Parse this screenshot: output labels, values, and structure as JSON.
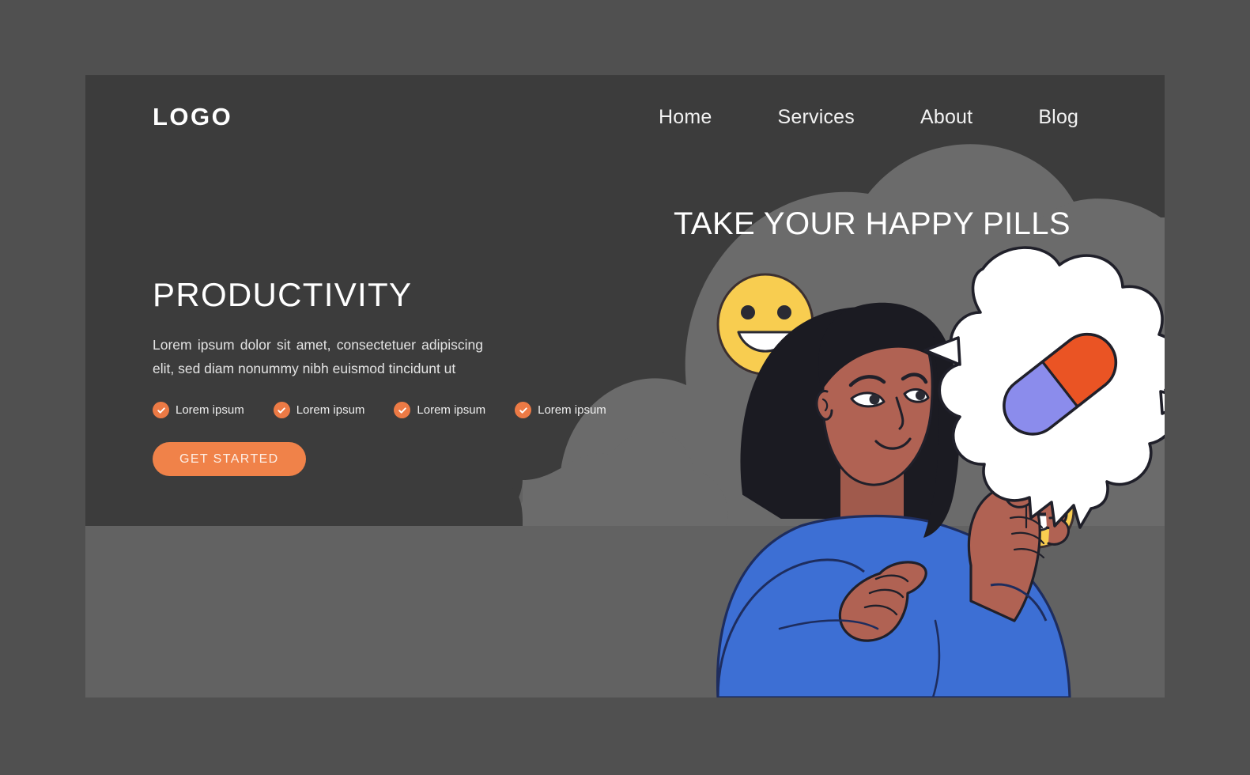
{
  "page": {
    "background_color": "#505050",
    "card_background": "#626262",
    "panel_color": "#3c3c3c",
    "cloud_color": "#6b6b6b",
    "accent_color": "#f08249"
  },
  "header": {
    "logo": "LOGO",
    "nav": [
      {
        "label": "Home"
      },
      {
        "label": "Services"
      },
      {
        "label": "About"
      },
      {
        "label": "Blog"
      }
    ]
  },
  "hero": {
    "headline": "PRODUCTIVITY",
    "subcopy": "Lorem ipsum dolor sit amet, consectetuer adipiscing elit, sed diam nonummy nibh euismod tincidunt ut",
    "features": [
      {
        "label": "Lorem ipsum",
        "icon": "check-circle-icon"
      },
      {
        "label": "Lorem ipsum",
        "icon": "check-circle-icon"
      },
      {
        "label": "Lorem ipsum",
        "icon": "check-circle-icon"
      },
      {
        "label": "Lorem ipsum",
        "icon": "check-circle-icon"
      }
    ],
    "cta_label": "GET STARTED"
  },
  "illustration": {
    "title": "TAKE YOUR HAPPY PILLS",
    "pill": {
      "left_half_color": "#8b8cec",
      "right_half_color": "#ea5424"
    },
    "character": {
      "skin_color": "#b06253",
      "hair_color": "#1b1b22",
      "shirt_color": "#3d6fd4"
    },
    "emoji_faces": [
      {
        "name": "smiley-face-large",
        "color": "#f8cd50"
      },
      {
        "name": "smiley-face-medium",
        "color": "#f8cd50"
      },
      {
        "name": "smiley-face-small",
        "color": "#f8cd50"
      }
    ],
    "speech_bubble_color": "#ffffff"
  }
}
